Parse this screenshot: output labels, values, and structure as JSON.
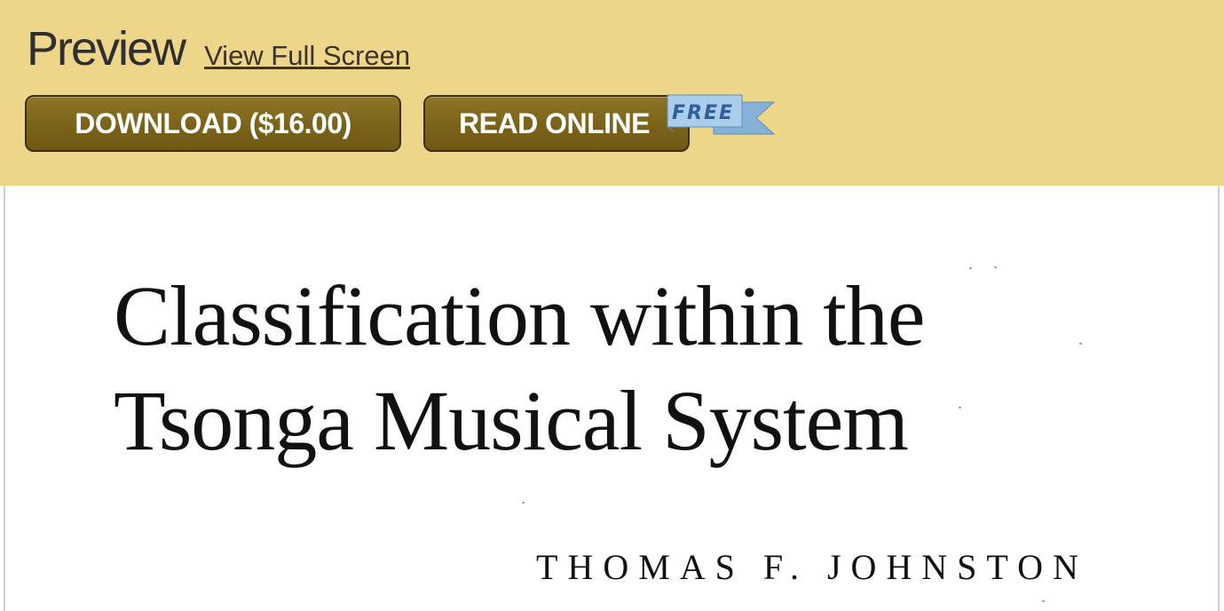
{
  "header": {
    "title": "Preview",
    "fullscreen_link": "View Full Screen",
    "download_button": "DOWNLOAD ($16.00)",
    "read_online_button": "READ ONLINE",
    "free_badge": "FREE"
  },
  "document": {
    "title_line_1": "Classification within the",
    "title_line_2": "Tsonga Musical System",
    "author": "THOMAS F. JOHNSTON"
  },
  "colors": {
    "header_background": "#edd68a",
    "button_background": "#7a6219",
    "ribbon_blue": "#9fc6e6"
  }
}
